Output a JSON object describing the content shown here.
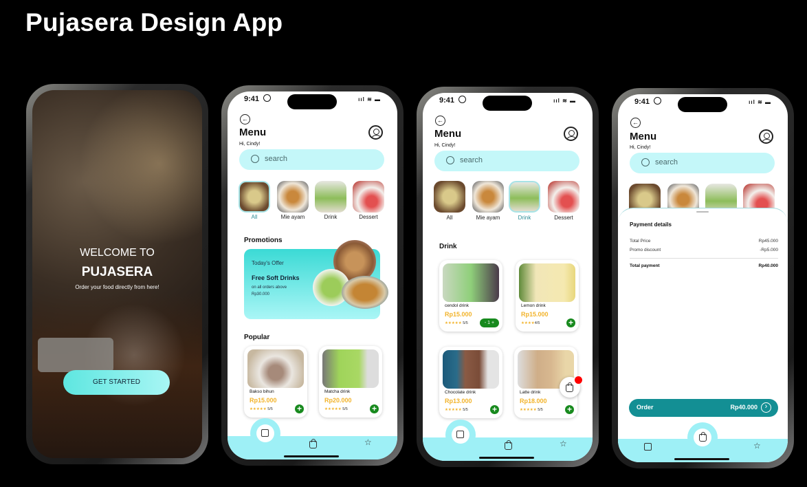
{
  "title": "Pujasera Design App",
  "status": {
    "time": "9:41",
    "signal": "ııl ≋ ▬"
  },
  "welcome": {
    "line1": "WELCOME TO",
    "line2": "PUJASERA",
    "subtitle": "Order your food directly from here!",
    "button": "GET STARTED"
  },
  "menu": {
    "back": "←",
    "title": "Menu",
    "greeting": "Hi, Cindy!",
    "search_placeholder": "search",
    "categories": [
      {
        "label": "All"
      },
      {
        "label": "Mie ayam"
      },
      {
        "label": "Drink"
      },
      {
        "label": "Dessert"
      }
    ]
  },
  "promotions": {
    "heading": "Promotions",
    "offer": "Today's Offer",
    "headline": "Free Soft Drinks",
    "condition": "on all orders above",
    "amount": "Rp30.000"
  },
  "popular": {
    "heading": "Popular",
    "items": [
      {
        "name": "Bakso bihun",
        "price": "Rp15.000",
        "stars": "★★★★★",
        "rating": "5/5"
      },
      {
        "name": "Matcha drink",
        "price": "Rp20.000",
        "stars": "★★★★★",
        "rating": "5/5"
      }
    ]
  },
  "drink": {
    "heading": "Drink",
    "stepper": "-  1  +",
    "items": [
      {
        "name": "cendol drink",
        "price": "Rp15.000",
        "stars": "★★★★★",
        "rating": "5/5"
      },
      {
        "name": "Lemon drink",
        "price": "Rp15.000",
        "stars": "★★★★",
        "rating": "4/5"
      },
      {
        "name": "Chocolate drink",
        "price": "Rp13.000",
        "stars": "★★★★★",
        "rating": "5/5"
      },
      {
        "name": "Latte drink",
        "price": "Rp18.000",
        "stars": "★★★★★",
        "rating": "5/5"
      }
    ]
  },
  "payment": {
    "heading": "Payment details",
    "total_price_label": "Total Price",
    "total_price": "Rp45.000",
    "promo_label": "Promo discount",
    "promo": "-Rp5.000",
    "total_label": "Total payment",
    "total": "Rp40.000",
    "order_label": "Order",
    "order_amount": "Rp40.000",
    "order_arrow": "›"
  },
  "colors": {
    "accent": "#9ef0f6",
    "search": "#c4f7f9",
    "order": "#138f94",
    "price": "#f2b32a",
    "add": "#188a1e",
    "badge": "#ff0000"
  },
  "icons": {
    "nav": [
      "store-icon",
      "bag-icon",
      "star-icon"
    ]
  }
}
